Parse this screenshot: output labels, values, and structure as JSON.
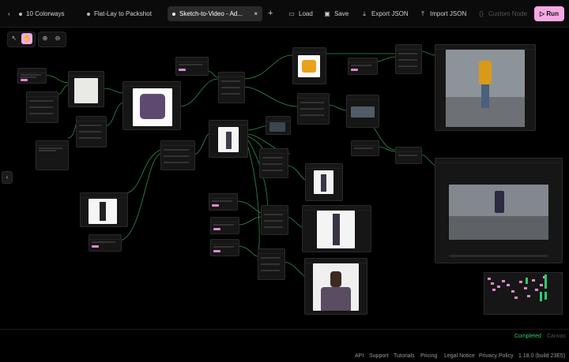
{
  "topbar": {
    "tabs": [
      {
        "label": "10 Colorways"
      },
      {
        "label": "Flat-Lay to Packshot"
      },
      {
        "label": "Sketch-to-Video - Ad..."
      }
    ],
    "add_tab": "+",
    "load": "Load",
    "save": "Save",
    "export": "Export JSON",
    "import": "Import JSON",
    "custom_node": "Custom Node",
    "run": "Run",
    "back": "‹",
    "close": "×"
  },
  "canvas": {
    "collapse": "‹"
  },
  "status": {
    "completed": "Completed",
    "canvas": "Canvas"
  },
  "footer": {
    "api": "API",
    "support": "Support",
    "tutorials": "Tutorials",
    "pricing": "Pricing",
    "legal": "Legal Notice",
    "privacy": "Privacy Policy",
    "version": "1.18.0 (build 23E5)"
  },
  "colors": {
    "accent": "#f7a8e4",
    "edge": "#3fbf6a",
    "success": "#2ecc71"
  }
}
